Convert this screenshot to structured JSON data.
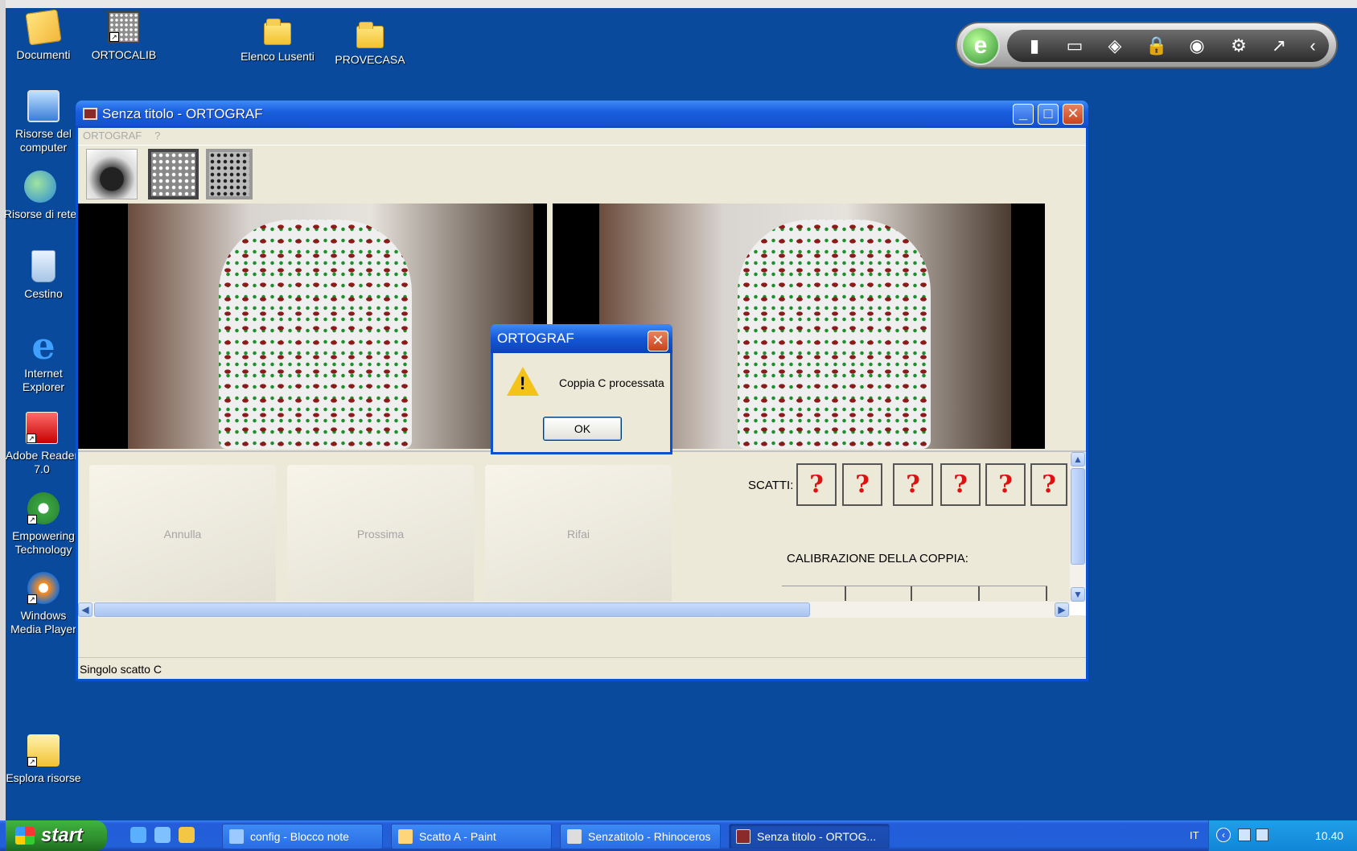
{
  "desktop": {
    "icons": [
      {
        "label": "Documenti"
      },
      {
        "label": "ORTOCALIB"
      },
      {
        "label": "Elenco Lusenti"
      },
      {
        "label": "PROVECASA"
      },
      {
        "label": "Risorse del computer"
      },
      {
        "label": "Risorse di rete"
      },
      {
        "label": "Cestino"
      },
      {
        "label": "Internet Explorer"
      },
      {
        "label": "Adobe Reader 7.0"
      },
      {
        "label": "Empowering Technology"
      },
      {
        "label": "Windows Media Player"
      },
      {
        "label": "Esplora risorse"
      }
    ]
  },
  "window": {
    "title": "Senza titolo - ORTOGRAF",
    "menu": [
      "ORTOGRAF",
      "?"
    ],
    "toolbar": [
      "camera-icon",
      "calibration-grid-icon",
      "dot-grid-icon"
    ],
    "buttons": {
      "annulla": "Annulla",
      "prossima": "Prossima",
      "rifai": "Rifai"
    },
    "scatti_label": "SCATTI:",
    "scatti": [
      "?",
      "?",
      "?",
      "?",
      "?",
      "?"
    ],
    "calibrazione_label": "CALIBRAZIONE DELLA COPPIA:",
    "status": "Singolo scatto C"
  },
  "dialog": {
    "title": "ORTOGRAF",
    "message": "Coppia C processata",
    "ok": "OK"
  },
  "taskbar": {
    "start": "start",
    "tasks": [
      {
        "label": "config - Blocco note"
      },
      {
        "label": "Scatto A - Paint"
      },
      {
        "label": "Senzatitolo - Rhinoceros"
      },
      {
        "label": "Senza titolo - ORTOG..."
      }
    ],
    "language": "IT",
    "clock": "10.40"
  },
  "colors": {
    "desktop": "#0a4a9c",
    "titlebar": "#1352d0",
    "accent_red": "#d11111"
  }
}
